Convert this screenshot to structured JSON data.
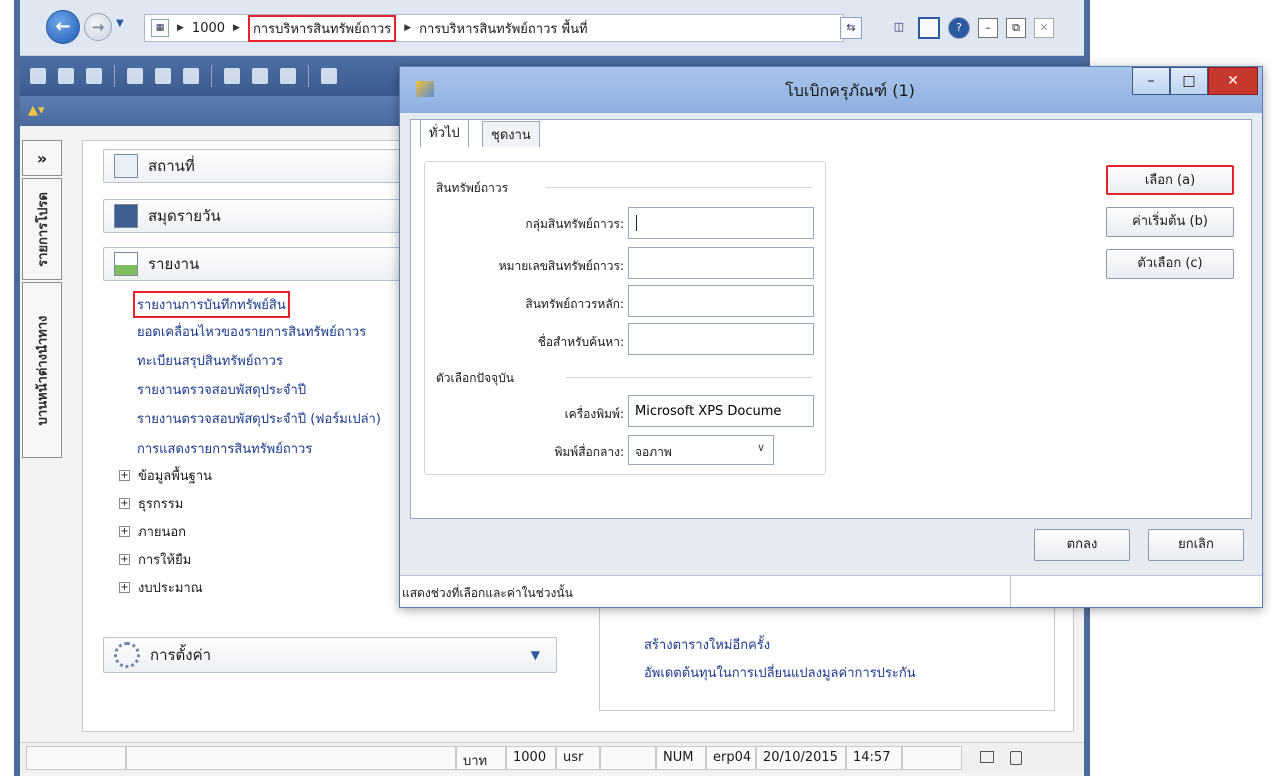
{
  "address_bar": {
    "crumbs": [
      "1000",
      "การบริหารสินทรัพย์ถาวร",
      "การบริหารสินทรัพย์ถาวร พื้นที่"
    ]
  },
  "vertical_tabs": [
    "รายการโปรด",
    "บานหน้าต่างนำทาง"
  ],
  "nav_groups": {
    "places": "สถานที่",
    "journals": "สมุดรายวัน",
    "reports": "รายงาน"
  },
  "report_links": [
    "รายงานการบันทึกทรัพย์สิน",
    "ยอดเคลื่อนไหวของรายการสินทรัพย์ถาวร",
    "ทะเบียนสรุปสินทรัพย์ถาวร",
    "รายงานตรวจสอบพัสดุประจำปี",
    "รายงานตรวจสอบพัสดุประจำปี (ฟอร์มเปล่า)",
    "การแสดงรายการสินทรัพย์ถาวร"
  ],
  "tree_items": [
    "ข้อมูลพื้นฐาน",
    "ธุรกรรม",
    "ภายนอก",
    "การให้ยืม",
    "งบประมาณ"
  ],
  "settings_label": "การตั้งค่า",
  "right_links": [
    "สร้างตารางใหม่อีกครั้ง",
    "อัพเดตต้นทุนในการเปลี่ยนแปลงมูลค่าการประกัน"
  ],
  "status_bar": {
    "currency": "บาท",
    "company": "1000",
    "user": "usr",
    "num": "NUM",
    "server": "erp04",
    "date": "20/10/2015",
    "time": "14:57"
  },
  "dialog": {
    "title": "โบเบิกครุภัณฑ์ (1)",
    "tabs": [
      "ทั่วไป",
      "ชุดงาน"
    ],
    "section_asset": "สินทรัพย์ถาวร",
    "section_current": "ตัวเลือกปัจจุบัน",
    "fields": {
      "asset_group": {
        "label": "กลุ่มสินทรัพย์ถาวร:",
        "value": ""
      },
      "asset_number": {
        "label": "หมายเลขสินทรัพย์ถาวร:",
        "value": ""
      },
      "main_asset": {
        "label": "สินทรัพย์ถาวรหลัก:",
        "value": ""
      },
      "search_name": {
        "label": "ชื่อสำหรับค้นหา:",
        "value": ""
      },
      "printer": {
        "label": "เครื่องพิมพ์:",
        "value": "Microsoft XPS Docume"
      },
      "print_medium": {
        "label": "พิมพ์สื่อกลาง:",
        "value": "จอภาพ"
      }
    },
    "buttons": {
      "select": "เลือก (a)",
      "defaults": "ค่าเริ่มต้น (b)",
      "options": "ตัวเลือก (c)",
      "ok": "ตกลง",
      "cancel": "ยกเลิก"
    },
    "status_text": "แสดงช่วงที่เลือกและค่าในช่วงนั้น"
  },
  "colors": {
    "highlight": "#e8202a",
    "link": "#1b3a8c",
    "titlebar": "#8eb0e0"
  }
}
